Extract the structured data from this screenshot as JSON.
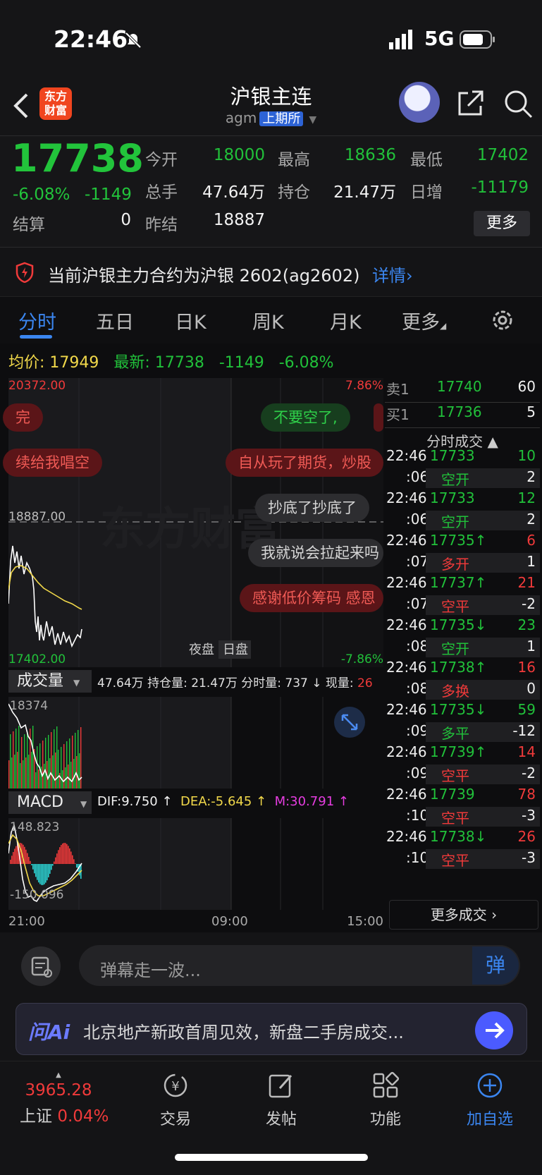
{
  "status": {
    "time": "22:46",
    "network": "5G"
  },
  "header": {
    "logo_text_1": "东方",
    "logo_text_2": "财富",
    "title": "沪银主连",
    "code": "agm",
    "exchange": "上期所"
  },
  "quote": {
    "price": "17738",
    "pct": "-6.08%",
    "chg": "-1149",
    "open_label": "今开",
    "open": "18000",
    "high_label": "最高",
    "high": "18636",
    "low_label": "最低",
    "low": "17402",
    "vol_label": "总手",
    "vol": "47.64万",
    "oi_label": "持仓",
    "oi": "21.47万",
    "inc_label": "日增",
    "inc": "-11179",
    "settle_label": "结算",
    "settle": "0",
    "prev_label": "昨结",
    "prev": "18887",
    "more": "更多"
  },
  "notice": {
    "text": "当前沪银主力合约为沪银 2602(ag2602)",
    "link": "详情›"
  },
  "tabs": [
    "分时",
    "五日",
    "日K",
    "周K",
    "月K",
    "更多"
  ],
  "infoline": {
    "avg_label": "均价:",
    "avg": "17949",
    "last_label": "最新:",
    "last": "17738",
    "chg": "-1149",
    "pct": "-6.08%"
  },
  "chart": {
    "top_price": "20372.00",
    "top_pct": "7.86%",
    "mid_price": "18887.00",
    "bot_price": "17402.00",
    "bot_pct": "-7.86%",
    "watermark": "东方财富",
    "session_night": "夜盘",
    "session_day": "日盘",
    "danmu": [
      "完",
      "不要空了,",
      "续给我唱空",
      "自从玩了期货，炒股",
      "抄底了抄底了",
      "我就说会拉起来吗",
      "感谢低价筹码 感恩"
    ]
  },
  "volume": {
    "selector": "成交量",
    "info": "47.64万 持仓量: 21.47万 分时量: 737 ↓ 现量: ",
    "now": "26",
    "max_label": "18374"
  },
  "macd": {
    "selector": "MACD",
    "dif": "DIF:9.750 ↑",
    "dea": "DEA:-5.645 ↑",
    "m": "M:30.791 ↑",
    "top_label": "148.823",
    "bot_label": "-150.096"
  },
  "xaxis": [
    "21:00",
    "09:00",
    "15:00"
  ],
  "orderbook": {
    "sell_label": "卖1",
    "sell_price": "17740",
    "sell_qty": "60",
    "buy_label": "买1",
    "buy_price": "17736",
    "buy_qty": "5",
    "trades_title": "分时成交 ▲"
  },
  "trades": [
    {
      "t": "22:46",
      "p": "17733",
      "pc": "green",
      "q": "10",
      "qc": "green",
      "s": ":06",
      "k": "空开",
      "kc": "green",
      "n": "2"
    },
    {
      "t": "22:46",
      "p": "17733",
      "pc": "green",
      "q": "12",
      "qc": "green",
      "s": ":06",
      "k": "空开",
      "kc": "green",
      "n": "2"
    },
    {
      "t": "22:46",
      "p": "17735↑",
      "pc": "green",
      "q": "6",
      "qc": "red",
      "s": ":07",
      "k": "多开",
      "kc": "red",
      "n": "1"
    },
    {
      "t": "22:46",
      "p": "17737↑",
      "pc": "green",
      "q": "21",
      "qc": "red",
      "s": ":07",
      "k": "空平",
      "kc": "red",
      "n": "-2"
    },
    {
      "t": "22:46",
      "p": "17735↓",
      "pc": "green",
      "q": "23",
      "qc": "green",
      "s": ":08",
      "k": "空开",
      "kc": "green",
      "n": "1"
    },
    {
      "t": "22:46",
      "p": "17738↑",
      "pc": "green",
      "q": "16",
      "qc": "red",
      "s": ":08",
      "k": "多换",
      "kc": "red",
      "n": "0"
    },
    {
      "t": "22:46",
      "p": "17735↓",
      "pc": "green",
      "q": "59",
      "qc": "green",
      "s": ":09",
      "k": "多平",
      "kc": "green",
      "n": "-12"
    },
    {
      "t": "22:46",
      "p": "17739↑",
      "pc": "green",
      "q": "14",
      "qc": "red",
      "s": ":09",
      "k": "空平",
      "kc": "red",
      "n": "-2"
    },
    {
      "t": "22:46",
      "p": "17739",
      "pc": "green",
      "q": "78",
      "qc": "red",
      "s": ":10",
      "k": "空平",
      "kc": "red",
      "n": "-3"
    },
    {
      "t": "22:46",
      "p": "17738↓",
      "pc": "green",
      "q": "26",
      "qc": "red",
      "s": ":10",
      "k": "空平",
      "kc": "red",
      "n": "-3"
    }
  ],
  "more_trades": "更多成交 ›",
  "comment": {
    "placeholder": "弹幕走一波...",
    "button": "弹"
  },
  "ai": {
    "logo": "问Ai",
    "text": "北京地产新政首周见效，新盘二手房成交..."
  },
  "nav": {
    "index_value": "3965.28",
    "index_name": "上证",
    "index_pct": "0.04%",
    "trade": "交易",
    "post": "发帖",
    "func": "功能",
    "add": "加自选"
  },
  "colors": {
    "up": "#f03a3a",
    "down": "#21c03a",
    "accent": "#3b86f0",
    "avg": "#f1d84a"
  }
}
